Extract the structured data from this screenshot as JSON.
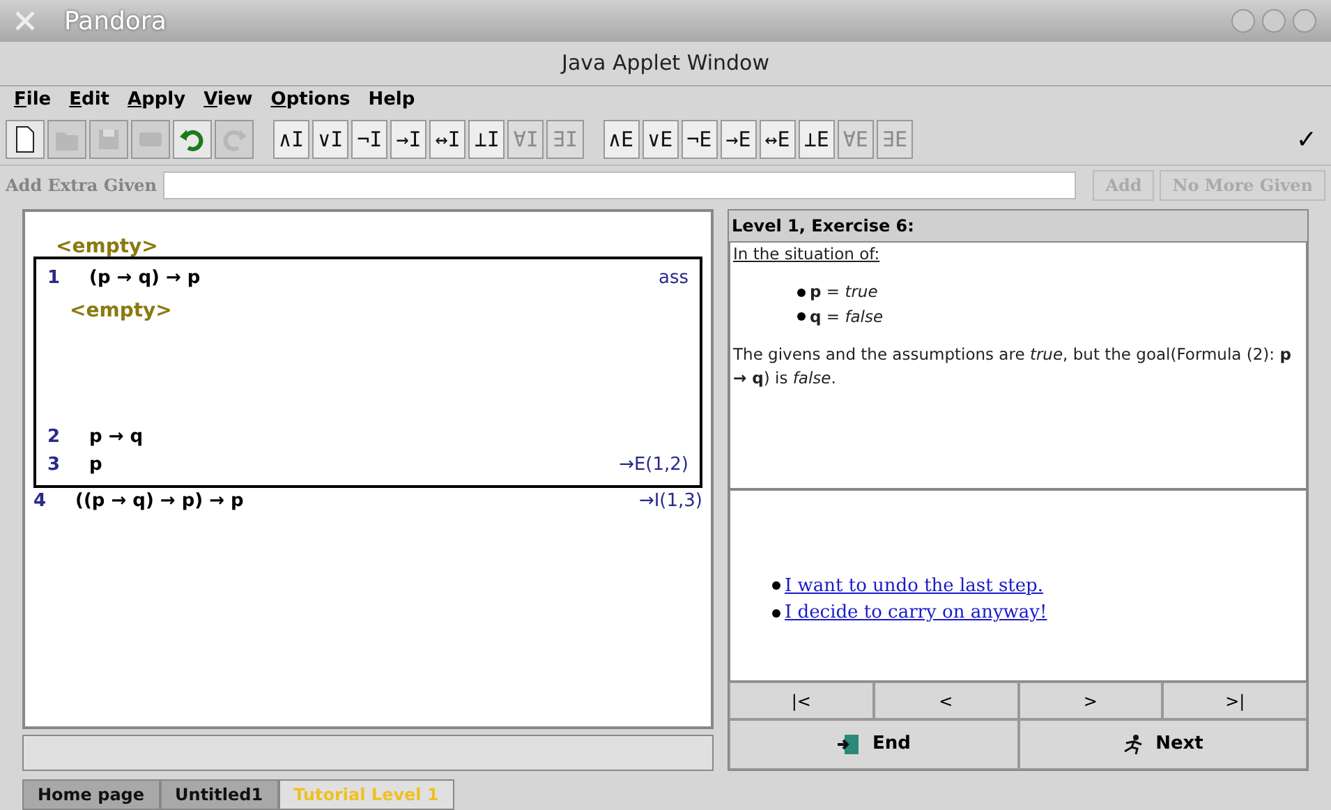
{
  "window": {
    "title": "Pandora"
  },
  "applet_title": "Java Applet Window",
  "menu": [
    {
      "label": "File",
      "mnemonic": true
    },
    {
      "label": "Edit",
      "mnemonic": true
    },
    {
      "label": "Apply",
      "mnemonic": true
    },
    {
      "label": "View",
      "mnemonic": true
    },
    {
      "label": "Options",
      "mnemonic": true
    },
    {
      "label": "Help",
      "mnemonic": false
    }
  ],
  "toolbar": {
    "file_tools": [
      {
        "kind": "new",
        "disabled": false
      },
      {
        "kind": "open",
        "disabled": true
      },
      {
        "kind": "save",
        "disabled": true
      },
      {
        "kind": "print",
        "disabled": true
      },
      {
        "kind": "undo",
        "disabled": false
      },
      {
        "kind": "redo",
        "disabled": true
      }
    ],
    "intro_rules": [
      {
        "label": "∧I",
        "disabled": false
      },
      {
        "label": "∨I",
        "disabled": false
      },
      {
        "label": "¬I",
        "disabled": false
      },
      {
        "label": "→I",
        "disabled": false
      },
      {
        "label": "↔I",
        "disabled": false
      },
      {
        "label": "⊥I",
        "disabled": false
      },
      {
        "label": "∀I",
        "disabled": true
      },
      {
        "label": "∃I",
        "disabled": true
      }
    ],
    "elim_rules": [
      {
        "label": "∧E",
        "disabled": false
      },
      {
        "label": "∨E",
        "disabled": false
      },
      {
        "label": "¬E",
        "disabled": false
      },
      {
        "label": "→E",
        "disabled": false
      },
      {
        "label": "↔E",
        "disabled": false
      },
      {
        "label": "⊥E",
        "disabled": false
      },
      {
        "label": "∀E",
        "disabled": true
      },
      {
        "label": "∃E",
        "disabled": true
      }
    ],
    "check": "✓"
  },
  "given_row": {
    "label": "Add Extra Given",
    "add": "Add",
    "no_more": "No More Given"
  },
  "proof": [
    {
      "kind": "placeholder",
      "text": "<empty>"
    },
    {
      "kind": "box",
      "children": [
        {
          "kind": "line",
          "number": "1",
          "formula": "(p → q) → p",
          "justification": "ass"
        },
        {
          "kind": "placeholder",
          "text": "<empty>"
        },
        {
          "kind": "gap"
        },
        {
          "kind": "line",
          "number": "2",
          "formula": "p → q"
        },
        {
          "kind": "line",
          "number": "3",
          "formula": "p",
          "justification": "→E(1,2)"
        }
      ]
    },
    {
      "kind": "line",
      "number": "4",
      "formula": "((p → q) → p) → p",
      "justification": "→I(1,3)"
    }
  ],
  "exercise": {
    "heading": "Level 1, Exercise 6:",
    "intro": "In the situation of:",
    "valuations": [
      "**p** = *true*",
      "**q** = *false*"
    ],
    "explanation": "The givens and the assumptions are *true*, but the goal(Formula (2): **p → q**) is *false*.",
    "links": [
      "I want to undo the last step.",
      "I decide to carry on anyway!"
    ],
    "nav": [
      "|<",
      "<",
      ">",
      ">|"
    ],
    "actions": [
      {
        "kind": "end",
        "label": "End"
      },
      {
        "kind": "next",
        "label": "Next"
      }
    ]
  },
  "tabs": [
    {
      "label": "Home page",
      "selected": false
    },
    {
      "label": "Untitled1",
      "selected": false
    },
    {
      "label": "Tutorial Level 1",
      "selected": true
    }
  ]
}
